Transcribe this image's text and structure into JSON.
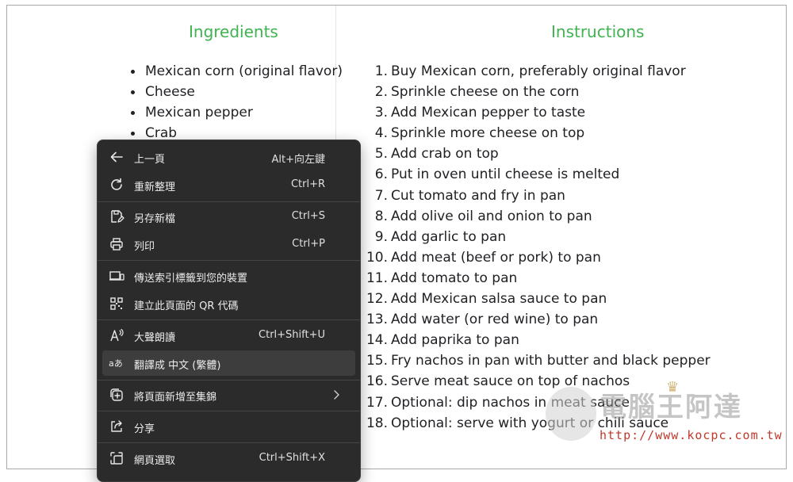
{
  "ingredients": {
    "heading": "Ingredients",
    "items": [
      "Mexican corn (original flavor)",
      "Cheese",
      "Mexican pepper",
      "Crab"
    ]
  },
  "instructions": {
    "heading": "Instructions",
    "steps": [
      "Buy Mexican corn, preferably original flavor",
      "Sprinkle cheese on the corn",
      "Add Mexican pepper to taste",
      "Sprinkle more cheese on top",
      "Add crab on top",
      "Put in oven until cheese is melted",
      "Cut tomato and fry in pan",
      "Add olive oil and onion to pan",
      "Add garlic to pan",
      "Add meat (beef or pork) to pan",
      "Add tomato to pan",
      "Add Mexican salsa sauce to pan",
      "Add water (or red wine) to pan",
      "Add paprika to pan",
      "Fry nachos in pan with butter and black pepper",
      "Serve meat sauce on top of nachos",
      "Optional: dip nachos in meat sauce",
      "Optional: serve with yogurt or chili sauce"
    ]
  },
  "context_menu": {
    "items": [
      {
        "label": "上一頁",
        "shortcut": "Alt+向左鍵",
        "icon": "back-arrow-icon"
      },
      {
        "label": "重新整理",
        "shortcut": "Ctrl+R",
        "icon": "refresh-icon"
      },
      {
        "label": "另存新檔",
        "shortcut": "Ctrl+S",
        "icon": "save-as-icon"
      },
      {
        "label": "列印",
        "shortcut": "Ctrl+P",
        "icon": "print-icon"
      },
      {
        "label": "傳送索引標籤到您的裝置",
        "shortcut": "",
        "icon": "send-to-device-icon"
      },
      {
        "label": "建立此頁面的 QR 代碼",
        "shortcut": "",
        "icon": "qr-code-icon"
      },
      {
        "label": "大聲朗讀",
        "shortcut": "Ctrl+Shift+U",
        "icon": "read-aloud-icon"
      },
      {
        "label": "翻譯成 中文 (繁體)",
        "shortcut": "",
        "icon": "translate-icon"
      },
      {
        "label": "將頁面新增至集錦",
        "shortcut": "",
        "icon": "add-to-collections-icon"
      },
      {
        "label": "分享",
        "shortcut": "",
        "icon": "share-icon"
      },
      {
        "label": "網頁選取",
        "shortcut": "Ctrl+Shift+X",
        "icon": "web-select-icon"
      }
    ]
  },
  "watermark": {
    "name": "電腦王阿達",
    "url": "http://www.kocpc.com.tw"
  },
  "colors": {
    "heading_green": "#3fb34f",
    "menu_bg": "#2b2b2b",
    "menu_highlight": "#3d3d3d",
    "watermark_url_red": "#c0392b"
  }
}
